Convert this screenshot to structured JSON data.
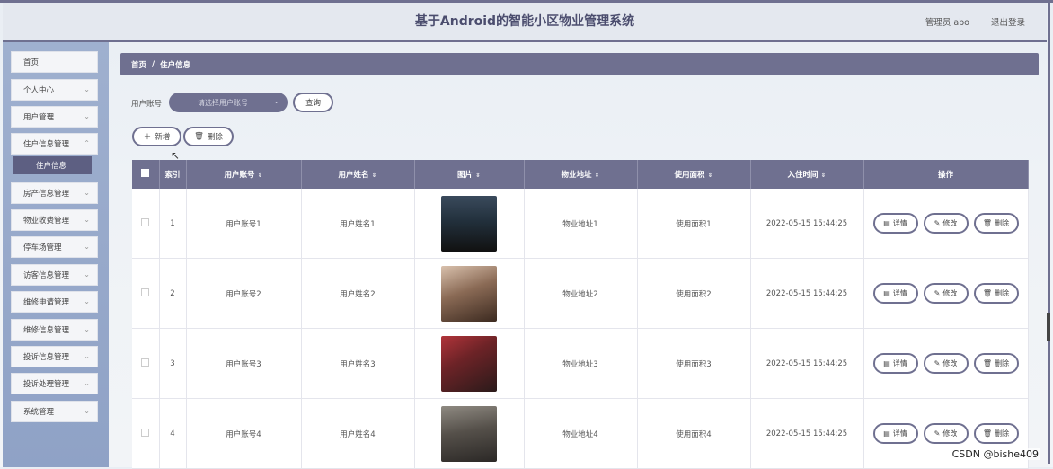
{
  "header": {
    "title": "基于Android的智能小区物业管理系统",
    "user": "管理员 abo",
    "logout": "退出登录"
  },
  "sidebar": {
    "items": [
      {
        "label": "首页"
      },
      {
        "label": "个人中心"
      },
      {
        "label": "用户管理"
      },
      {
        "label": "住户信息管理"
      },
      {
        "label": "住户信息"
      },
      {
        "label": "房产信息管理"
      },
      {
        "label": "物业收费管理"
      },
      {
        "label": "停车场管理"
      },
      {
        "label": "访客信息管理"
      },
      {
        "label": "维修申请管理"
      },
      {
        "label": "维修信息管理"
      },
      {
        "label": "投诉信息管理"
      },
      {
        "label": "投诉处理管理"
      },
      {
        "label": "系统管理"
      }
    ]
  },
  "breadcrumb": {
    "home": "首页",
    "sep": "/",
    "current": "住户信息"
  },
  "search": {
    "label": "用户账号",
    "placeholder": "请选择用户账号",
    "button": "查询"
  },
  "actions": {
    "add": "新增",
    "delete": "删除"
  },
  "table": {
    "headers": [
      "索引",
      "用户账号",
      "用户姓名",
      "图片",
      "物业地址",
      "使用面积",
      "入住时间",
      "操作"
    ],
    "rows": [
      {
        "index": "1",
        "account": "用户账号1",
        "name": "用户姓名1",
        "address": "物业地址1",
        "area": "使用面积1",
        "time": "2022-05-15 15:44:25"
      },
      {
        "index": "2",
        "account": "用户账号2",
        "name": "用户姓名2",
        "address": "物业地址2",
        "area": "使用面积2",
        "time": "2022-05-15 15:44:25"
      },
      {
        "index": "3",
        "account": "用户账号3",
        "name": "用户姓名3",
        "address": "物业地址3",
        "area": "使用面积3",
        "time": "2022-05-15 15:44:25"
      },
      {
        "index": "4",
        "account": "用户账号4",
        "name": "用户姓名4",
        "address": "物业地址4",
        "area": "使用面积4",
        "time": "2022-05-15 15:44:25"
      }
    ],
    "ops": {
      "detail": "详情",
      "edit": "修改",
      "delete": "删除"
    }
  },
  "colors": {
    "primary": "#6f7090",
    "sidebar": "#9fb0cf",
    "active": "#5d5f82"
  },
  "watermark": "CSDN @bishe409"
}
